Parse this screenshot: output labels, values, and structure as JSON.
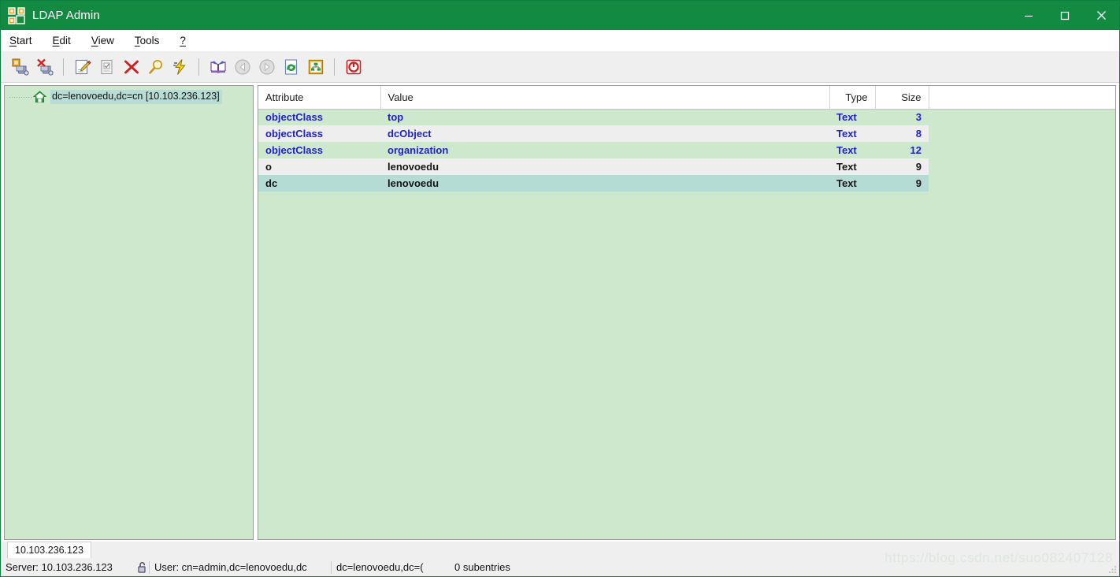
{
  "window": {
    "title": "LDAP Admin",
    "icon": "ldap-network-icon",
    "titlebar_color": "#128a42",
    "minimize": "—",
    "maximize": "□",
    "close": "✕"
  },
  "menubar": {
    "items": [
      {
        "label": "Start",
        "accel": "S",
        "rest": "tart"
      },
      {
        "label": "Edit",
        "accel": "E",
        "rest": "dit"
      },
      {
        "label": "View",
        "accel": "V",
        "rest": "iew"
      },
      {
        "label": "Tools",
        "accel": "T",
        "rest": "ools"
      },
      {
        "label": "?",
        "accel": "?",
        "rest": ""
      }
    ]
  },
  "toolbar": {
    "buttons": [
      {
        "name": "connect-icon",
        "title": "Connect"
      },
      {
        "name": "disconnect-icon",
        "title": "Disconnect"
      },
      {
        "name": "separator-1",
        "title": ""
      },
      {
        "name": "edit-entry-icon",
        "title": "Edit entry"
      },
      {
        "name": "new-entry-icon",
        "title": "New entry"
      },
      {
        "name": "delete-entry-icon",
        "title": "Delete entry"
      },
      {
        "name": "search-icon",
        "title": "Search"
      },
      {
        "name": "run-script-icon",
        "title": "Run"
      },
      {
        "name": "separator-2",
        "title": ""
      },
      {
        "name": "dictionary-icon",
        "title": "Schema"
      },
      {
        "name": "back-arrow-icon",
        "title": "Back"
      },
      {
        "name": "forward-arrow-icon",
        "title": "Forward"
      },
      {
        "name": "refresh-icon",
        "title": "Refresh"
      },
      {
        "name": "org-chart-icon",
        "title": "Tree"
      },
      {
        "name": "separator-3",
        "title": ""
      },
      {
        "name": "power-off-icon",
        "title": "Exit"
      }
    ]
  },
  "tree": {
    "root": {
      "label": "dc=lenovoedu,dc=cn [10.103.236.123]",
      "icon": "green-house-icon",
      "selected": true
    }
  },
  "table": {
    "columns": [
      "Attribute",
      "Value",
      "Type",
      "Size"
    ],
    "rows": [
      {
        "attribute": "objectClass",
        "value": "top",
        "type": "Text",
        "size": "3",
        "style": "blue",
        "row": "green",
        "selected": false
      },
      {
        "attribute": "objectClass",
        "value": "dcObject",
        "type": "Text",
        "size": "8",
        "style": "blue",
        "row": "gray",
        "selected": false
      },
      {
        "attribute": "objectClass",
        "value": "organization",
        "type": "Text",
        "size": "12",
        "style": "blue",
        "row": "green",
        "selected": false
      },
      {
        "attribute": "o",
        "value": "lenovoedu",
        "type": "Text",
        "size": "9",
        "style": "black",
        "row": "gray",
        "selected": false
      },
      {
        "attribute": "dc",
        "value": "lenovoedu",
        "type": "Text",
        "size": "9",
        "style": "black",
        "row": "sel",
        "selected": true
      }
    ]
  },
  "statusbar": {
    "tab_label": "10.103.236.123",
    "server": "Server: 10.103.236.123",
    "lock_icon": "unlocked-padlock-icon",
    "user": "User: cn=admin,dc=lenovoedu,dc",
    "base_dn": "dc=lenovoedu,dc=(",
    "subentries": "0 subentries"
  },
  "watermark": {
    "text": "https://blog.csdn.net/suo082407128"
  }
}
